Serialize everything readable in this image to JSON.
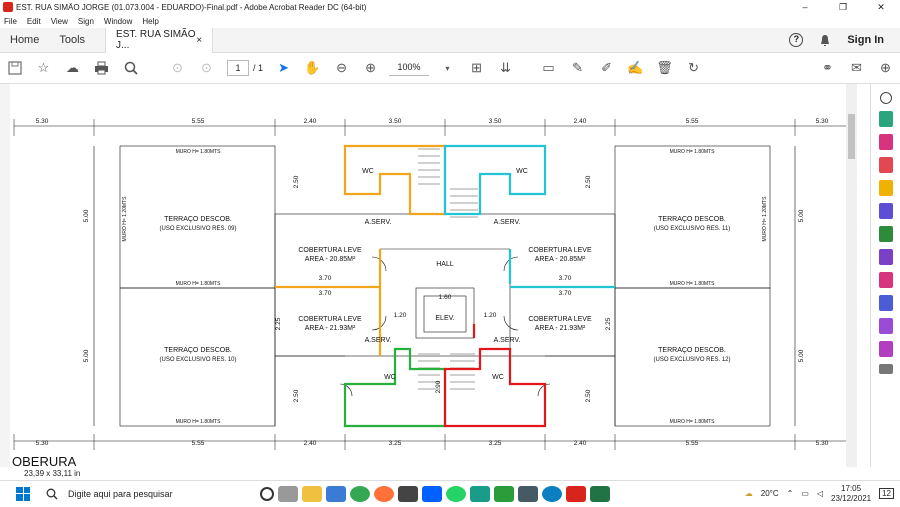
{
  "window": {
    "title": "EST. RUA SIMÃO JORGE (01.073.004 - EDUARDO)-Final.pdf - Adobe Acrobat Reader DC (64-bit)",
    "minimize": "–",
    "maximize": "❐",
    "close": "✕"
  },
  "menu": [
    "File",
    "Edit",
    "View",
    "Sign",
    "Window",
    "Help"
  ],
  "tabs": {
    "home": "Home",
    "tools": "Tools",
    "doc": "EST. RUA SIMÃO J...",
    "doc_close": "×",
    "signin": "Sign In",
    "help": "?"
  },
  "toolbar": {
    "page_current": "1",
    "page_total": "/ 1",
    "zoom": "100%"
  },
  "drawing": {
    "top_dims": [
      "5.30",
      "5.55",
      "2.40",
      "3.50",
      "3.50",
      "2.40",
      "5.55",
      "5.30"
    ],
    "bottom_dims": [
      "5.30",
      "5.55",
      "2.40",
      "3.25",
      "3.25",
      "2.40",
      "5.55",
      "5.30"
    ],
    "side_dim": "5.00",
    "terr_tl": "TERRAÇO DESCOB.",
    "terr_tl_sub": "(USO EXCLUSIVO RES. 09)",
    "terr_tr": "TERRAÇO DESCOB.",
    "terr_tr_sub": "(USO EXCLUSIVO RES. 11)",
    "terr_bl": "TERRAÇO DESCOB.",
    "terr_bl_sub": "(USO EXCLUSIVO RES. 10)",
    "terr_br": "TERRAÇO DESCOB.",
    "terr_br_sub": "(USO EXCLUSIVO RES. 12)",
    "cob_tl": "COBERTURA LEVE",
    "cob_tl_area": "AREA - 20.85M²",
    "cob_tr": "COBERTURA LEVE",
    "cob_tr_area": "AREA - 20.85M²",
    "cob_bl": "COBERTURA LEVE",
    "cob_bl_area": "AREA - 21.93M²",
    "cob_br": "COBERTURA LEVE",
    "cob_br_area": "AREA - 21.93M²",
    "aserv": "A.SERV.",
    "wc": "WC",
    "hall": "HALL",
    "elev": "ELEV.",
    "muro_top": "MURO H= 1.80MTS",
    "muro_side": "MURO H= 1.20MTS",
    "d370": "3.70",
    "d250": "2.50",
    "d225": "2.25",
    "d160": "1.60",
    "d120": "1.20",
    "d290": "2.90",
    "sheet_label": "OBERURA"
  },
  "status": {
    "size": "23,39 x 33,11 in"
  },
  "taskbar": {
    "search": "Digite aqui para pesquisar",
    "temp": "20°C",
    "time": "17:05",
    "date": "23/12/2021",
    "notif": "12"
  },
  "colors": {
    "orange": "#f2a51b",
    "cyan": "#21c4d6",
    "green": "#27b03b",
    "red": "#e3161b"
  }
}
